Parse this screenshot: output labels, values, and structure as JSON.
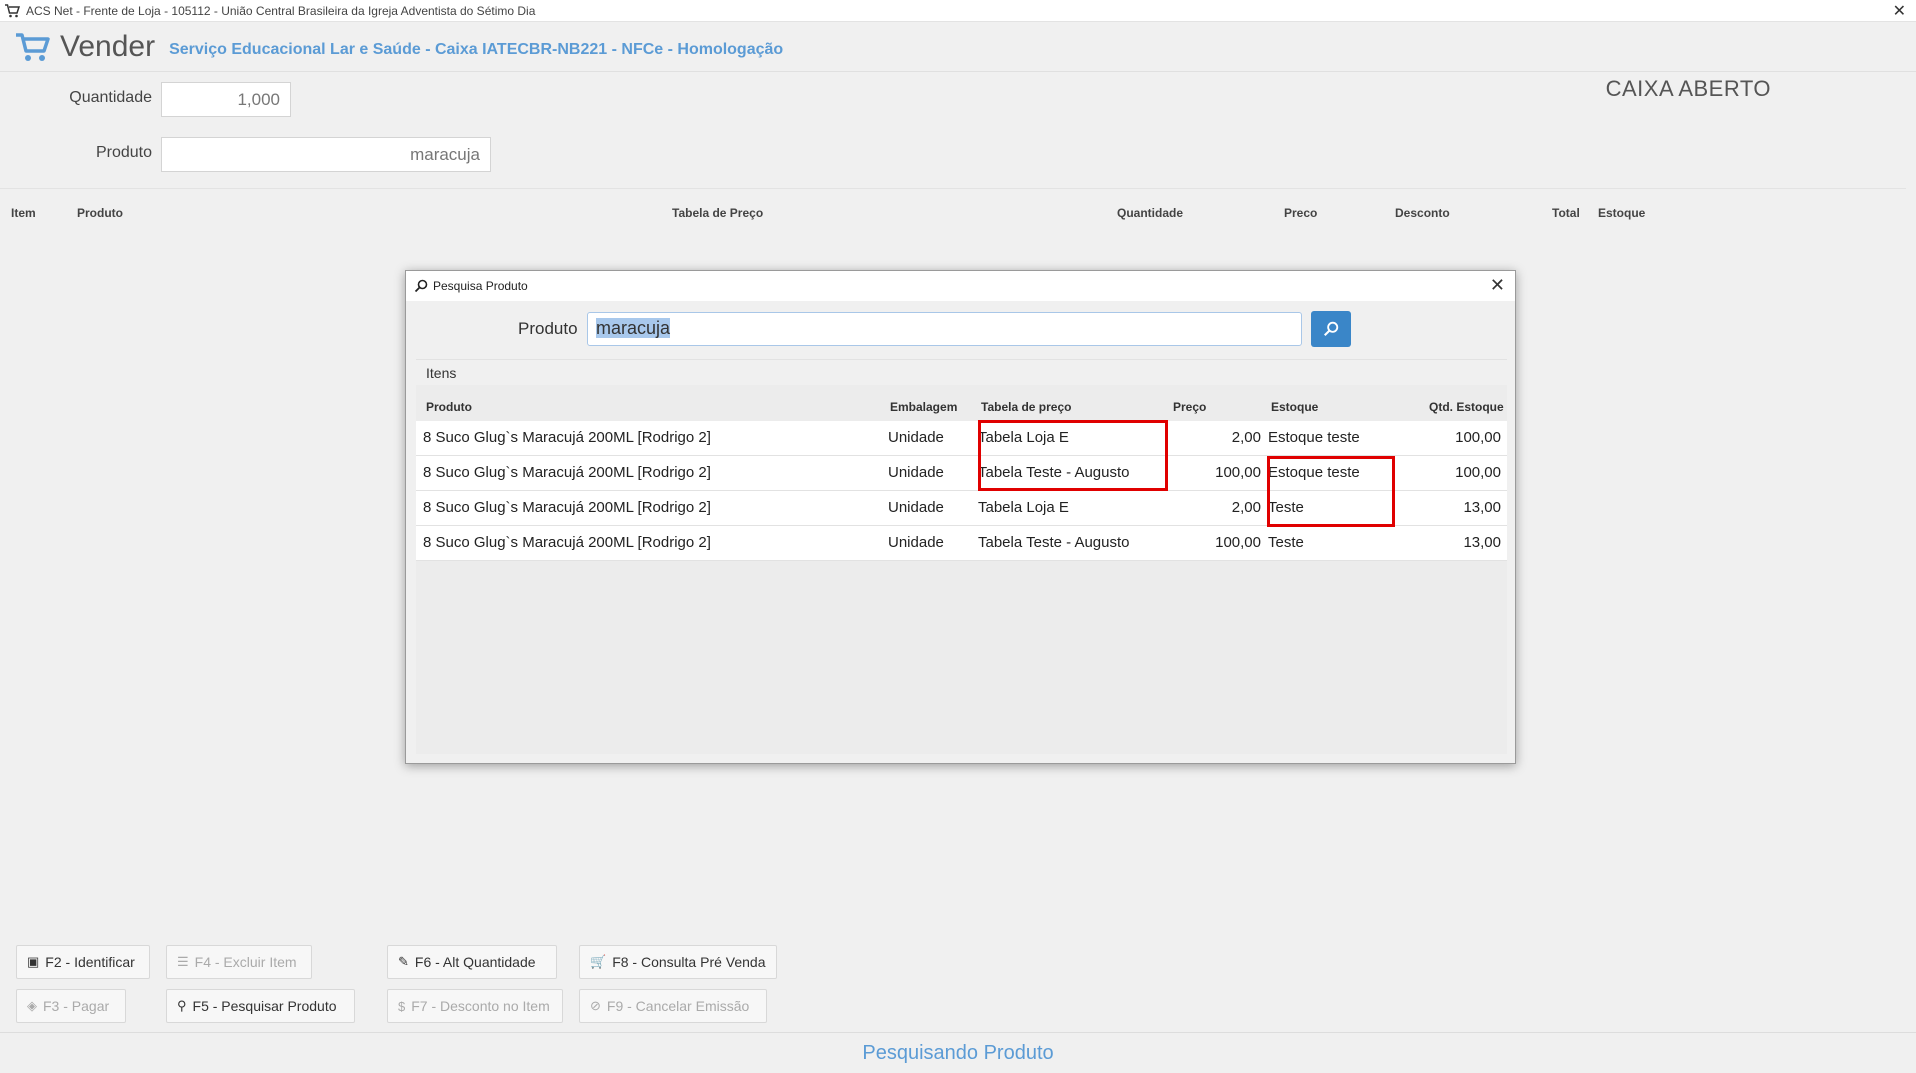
{
  "window": {
    "title": "ACS Net - Frente de Loja - 105112 - União Central Brasileira da Igreja Adventista do Sétimo Dia"
  },
  "header": {
    "title": "Vender",
    "subtitle": "Serviço Educacional Lar e Saúde - Caixa IATECBR-NB221 - NFCe - Homologação"
  },
  "form": {
    "quantidade_label": "Quantidade",
    "quantidade_value": "1,000",
    "produto_label": "Produto",
    "produto_value": "maracuja"
  },
  "status_caixa": "CAIXA ABERTO",
  "grid": {
    "columns": [
      "Item",
      "Produto",
      "Tabela de Preço",
      "Quantidade",
      "Preco",
      "Desconto",
      "Total",
      "Estoque"
    ]
  },
  "buttons": {
    "f2": "F2 - Identificar",
    "f4": "F4 - Excluir Item",
    "f6": "F6 - Alt Quantidade",
    "f8": "F8 - Consulta Pré Venda",
    "f3": "F3 - Pagar",
    "f5": "F5 - Pesquisar Produto",
    "f7": "F7 - Desconto no Item",
    "f9": "F9 - Cancelar Emissão"
  },
  "statusbar": "Pesquisando Produto",
  "modal": {
    "title": "Pesquisa Produto",
    "produto_label": "Produto",
    "search_value": "maracuja",
    "itens_label": "Itens",
    "columns": [
      "Produto",
      "Embalagem",
      "Tabela de preço",
      "Preço",
      "Estoque",
      "Qtd. Estoque"
    ],
    "rows": [
      {
        "produto": "8 Suco Glug`s Maracujá 200ML [Rodrigo 2]",
        "embalagem": "Unidade",
        "tabela": "Tabela Loja E",
        "preco": "2,00",
        "estoque": "Estoque teste",
        "qtd": "100,00"
      },
      {
        "produto": "8 Suco Glug`s Maracujá 200ML [Rodrigo 2]",
        "embalagem": "Unidade",
        "tabela": "Tabela Teste - Augusto",
        "preco": "100,00",
        "estoque": "Estoque teste",
        "qtd": "100,00"
      },
      {
        "produto": "8 Suco Glug`s Maracujá 200ML [Rodrigo 2]",
        "embalagem": "Unidade",
        "tabela": "Tabela Loja E",
        "preco": "2,00",
        "estoque": "Teste",
        "qtd": "13,00"
      },
      {
        "produto": "8 Suco Glug`s Maracujá 200ML [Rodrigo 2]",
        "embalagem": "Unidade",
        "tabela": "Tabela Teste - Augusto",
        "preco": "100,00",
        "estoque": "Teste",
        "qtd": "13,00"
      }
    ]
  },
  "colors": {
    "accent": "#5b9bd5",
    "search_button": "#3a86c8",
    "highlight": "#e00000"
  }
}
